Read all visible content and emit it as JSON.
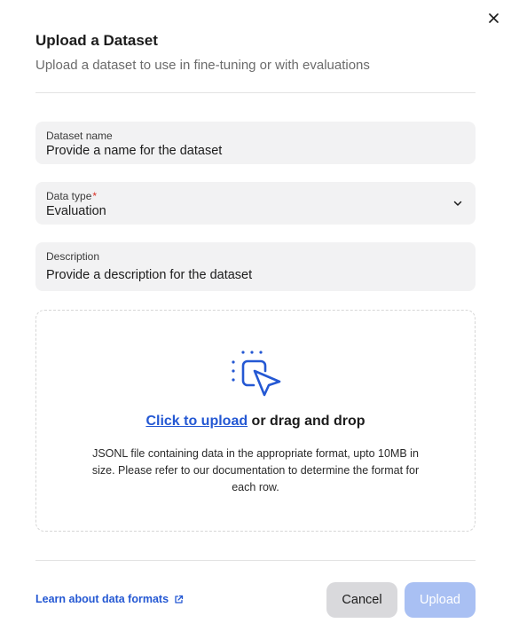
{
  "dialog": {
    "title": "Upload a Dataset",
    "subtitle": "Upload a dataset to use in fine-tuning or with evaluations"
  },
  "fields": {
    "name": {
      "label": "Dataset name",
      "placeholder": "Provide a name for the dataset"
    },
    "type": {
      "label": "Data type",
      "required_mark": "*",
      "value": "Evaluation"
    },
    "description": {
      "label": "Description",
      "placeholder": "Provide a description for the dataset"
    }
  },
  "dropzone": {
    "link_text": "Click to upload",
    "rest_text": " or drag and drop",
    "help_text": "JSONL file containing data in the appropriate format, upto 10MB in size. Please refer to our documentation to determine the format for each row.",
    "icon": "click-select-icon"
  },
  "footer": {
    "learn_link": "Learn about data formats",
    "cancel_label": "Cancel",
    "upload_label": "Upload"
  },
  "colors": {
    "accent": "#2458d3",
    "upload_disabled": "#a9c0f3",
    "field_bg": "#f2f2f3"
  }
}
